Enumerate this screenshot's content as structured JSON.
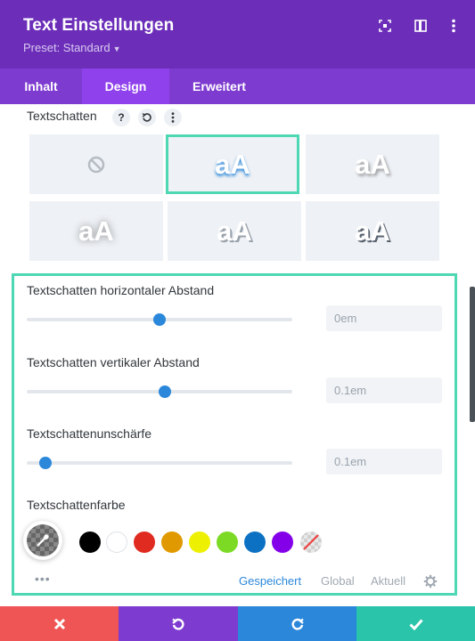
{
  "header": {
    "title": "Text Einstellungen",
    "preset_label": "Preset: Standard",
    "icons": [
      "focus-icon",
      "split-view-icon",
      "more-vertical-icon"
    ]
  },
  "tabs": [
    {
      "label": "Inhalt",
      "active": false
    },
    {
      "label": "Design",
      "active": true
    },
    {
      "label": "Erweitert",
      "active": false
    }
  ],
  "textschatten": {
    "label": "Textschatten",
    "help": "?",
    "presets": [
      {
        "name": "none",
        "text": ""
      },
      {
        "name": "preset-1",
        "text": "aA",
        "selected": true
      },
      {
        "name": "preset-2",
        "text": "aA"
      },
      {
        "name": "preset-3",
        "text": "aA"
      },
      {
        "name": "preset-4",
        "text": "aA"
      },
      {
        "name": "preset-5",
        "text": "aA"
      }
    ]
  },
  "fields": {
    "horizontal": {
      "label": "Textschatten horizontaler Abstand",
      "value": "0em",
      "slider_fraction": 0.5
    },
    "vertical": {
      "label": "Textschatten vertikaler Abstand",
      "value": "0.1em",
      "slider_fraction": 0.52
    },
    "blur": {
      "label": "Textschattenunschärfe",
      "value": "0.1em",
      "slider_fraction": 0.07
    },
    "color_label": "Textschattenfarbe"
  },
  "swatches": [
    "#000000",
    "#ffffff",
    "#e02b20",
    "#e09900",
    "#edf000",
    "#7cda24",
    "#0c71c3",
    "#8300e9"
  ],
  "footer": {
    "saved": "Gespeichert",
    "global": "Global",
    "current": "Aktuell"
  },
  "colors": {
    "header": "#6c2eb9",
    "tabs": "#7e3bd0",
    "active_tab": "#8f42ec",
    "accent": "#2b87da",
    "highlight": "#4ed7b3",
    "cancel": "#ef5555",
    "undo": "#7e3bd0",
    "redo": "#2b87da",
    "save": "#29c4a9"
  }
}
